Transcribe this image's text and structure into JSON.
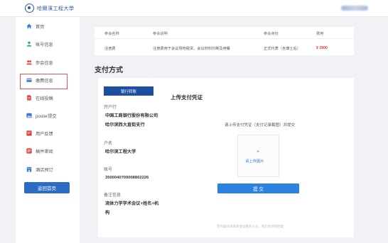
{
  "header": {
    "logo_text": "哈爾濱工程大學"
  },
  "sidebar": {
    "items": [
      {
        "label": "首页",
        "icon": "home-icon",
        "color": "#3a7bd5"
      },
      {
        "label": "账号信息",
        "icon": "account-icon",
        "color": "#3aa76d"
      },
      {
        "label": "参会信息",
        "icon": "attendees-icon",
        "color": "#e0403d"
      },
      {
        "label": "缴费信息",
        "icon": "payment-icon",
        "color": "#3a7bd5"
      },
      {
        "label": "在线投稿",
        "icon": "submission-icon",
        "color": "#e0403d"
      },
      {
        "label": "poster提交",
        "icon": "poster-icon",
        "color": "#3a7bd5"
      },
      {
        "label": "用户反馈",
        "icon": "feedback-icon",
        "color": "#e0403d"
      },
      {
        "label": "稿件审阅",
        "icon": "review-icon",
        "color": "#e0403d"
      },
      {
        "label": "酒店预订",
        "icon": "hotel-icon",
        "color": "#3a7bd5"
      }
    ],
    "back_button": "返回首页"
  },
  "fee_table": {
    "headers": [
      "参会名称",
      "参会说明",
      "参会身份",
      "费用"
    ],
    "row": [
      "注册费",
      "注册费用于会议场地租赁、会议材料印刷及用餐",
      "正式代表（含博士后）",
      "¥ 2800"
    ]
  },
  "payment": {
    "section_title": "支付方式",
    "bank_tag": "银行转账",
    "account_bank_label": "开户行",
    "account_bank_value": "中国工商银行股份有限公司哈尔滨西大直街支行",
    "account_name_label": "户名",
    "account_name_value": "哈尔滨工程大学",
    "account_number_label": "账号",
    "account_number_value": "3500040709008802226",
    "remark_label": "备注信息",
    "remark_value": "流体力学学术会议+姓名+机构"
  },
  "upload": {
    "title": "上传支付凭证",
    "hint": "请上传支付凭证（支付记录截图）并提交",
    "box_label": "请上传图片",
    "submit": "提 交",
    "footnote": "若有疑问请联系会议服务人员，我们会尽快回复"
  },
  "colors": {
    "primary": "#2c82e0",
    "bank_tag": "#1e4ea0",
    "price": "#e0403d",
    "highlight_box": "#e2555b"
  }
}
